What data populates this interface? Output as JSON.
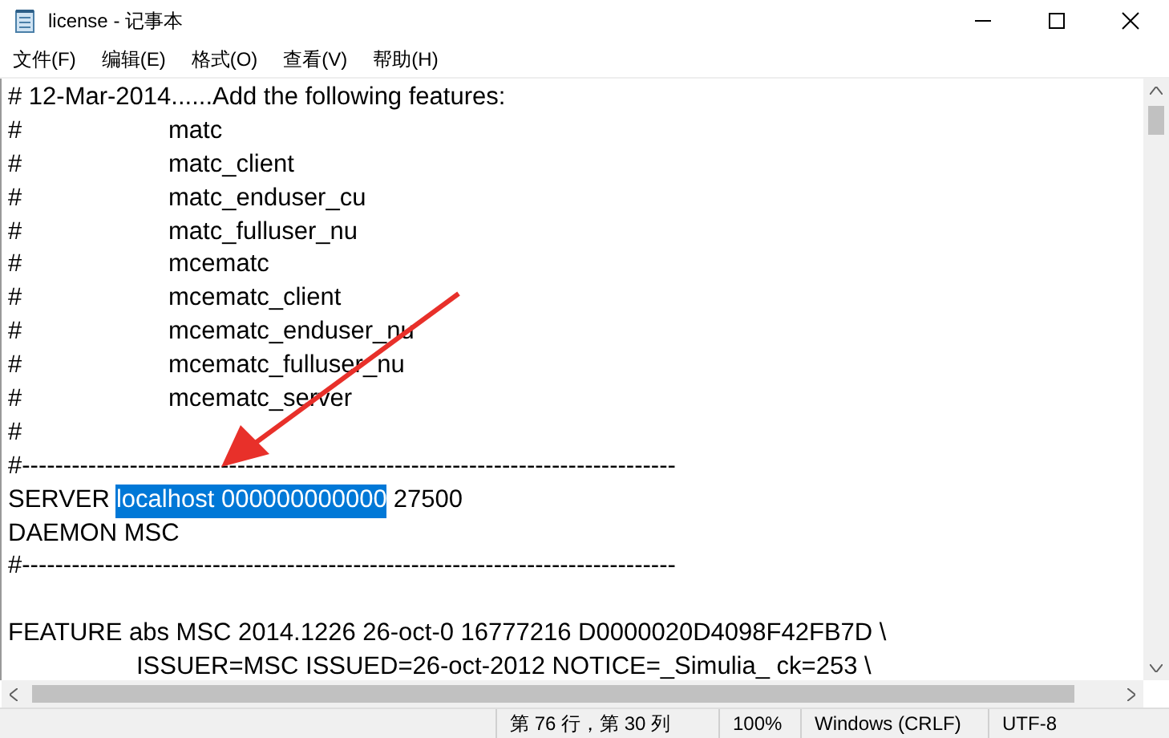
{
  "window": {
    "title": "license - 记事本"
  },
  "menu": [
    "文件(F)",
    "编辑(E)",
    "格式(O)",
    "查看(V)",
    "帮助(H)"
  ],
  "lines": [
    {
      "kind": "plain",
      "text": "# 12-Mar-2014......Add the following features:"
    },
    {
      "kind": "entry",
      "marker": "#",
      "text": "matc"
    },
    {
      "kind": "entry",
      "marker": "#",
      "text": "matc_client"
    },
    {
      "kind": "entry",
      "marker": "#",
      "text": "matc_enduser_cu"
    },
    {
      "kind": "entry",
      "marker": "#",
      "text": "matc_fulluser_nu"
    },
    {
      "kind": "entry",
      "marker": "#",
      "text": "mcematc"
    },
    {
      "kind": "entry",
      "marker": "#",
      "text": "mcematc_client"
    },
    {
      "kind": "entry",
      "marker": "#",
      "text": "mcematc_enduser_nu"
    },
    {
      "kind": "entry",
      "marker": "#",
      "text": "mcematc_fulluser_nu"
    },
    {
      "kind": "entry",
      "marker": "#",
      "text": "mcematc_server"
    },
    {
      "kind": "plain",
      "text": "#"
    },
    {
      "kind": "plain",
      "text": "#-------------------------------------------------------------------------------"
    },
    {
      "kind": "selection",
      "before": "SERVER",
      "selected": "localhost 000000000000",
      "after": "27500"
    },
    {
      "kind": "plain",
      "text": "DAEMON MSC"
    },
    {
      "kind": "plain",
      "text": "#-------------------------------------------------------------------------------"
    },
    {
      "kind": "blank"
    },
    {
      "kind": "plain",
      "text": "FEATURE abs MSC 2014.1226 26-oct-0 16777216 D0000020D4098F42FB7D \\"
    },
    {
      "kind": "continuation",
      "text": "ISSUER=MSC ISSUED=26-oct-2012 NOTICE=_Simulia_ ck=253 \\"
    }
  ],
  "status_bar": [
    "第 76 行，第 30 列",
    "100%",
    "Windows (CRLF)",
    "UTF-8"
  ]
}
